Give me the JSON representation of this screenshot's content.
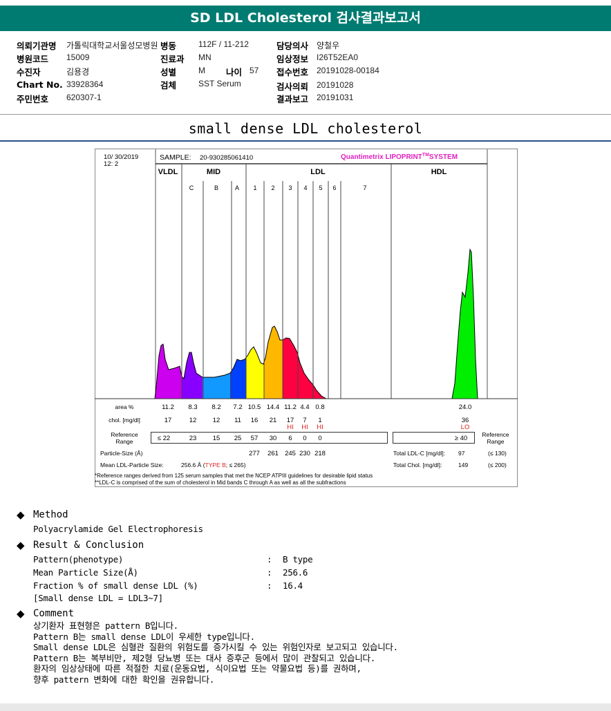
{
  "header": {
    "title": "SD LDL Cholesterol 검사결과보고서"
  },
  "info": {
    "institution_label": "의뢰기관명",
    "institution": "가톨릭대학교서울성모병원",
    "ward_label": "병동",
    "ward": "112F / 11-212",
    "doctor_label": "담당의사",
    "doctor": "양철우",
    "hospital_code_label": "병원코드",
    "hospital_code": "15009",
    "dept_label": "진료과",
    "dept": "MN",
    "clinical_label": "임상정보",
    "clinical": "I26T52EA0",
    "patient_label": "수진자",
    "patient": "김용경",
    "sex_label": "성별",
    "sex": "M",
    "age_label": "나이",
    "age": "57",
    "receipt_label": "접수번호",
    "receipt": "20191028-00184",
    "chart_label": "Chart No.",
    "chart_no": "33928364",
    "specimen_label": "검체",
    "specimen": "SST Serum",
    "request_label": "검사의뢰",
    "request": "20191028",
    "id_label": "주민번호",
    "id": "620307-1",
    "report_label": "결과보고",
    "report": "20191031"
  },
  "subtitle": "small dense LDL cholesterol",
  "chart_data": {
    "type": "area",
    "date": "10/ 30/2019",
    "time": "12:  2",
    "sample_label": "SAMPLE:",
    "sample": "20-930285061410",
    "brand": "Quantimetrix LIPOPRINT",
    "brand_tm": "TM",
    "brand_suffix": "SYSTEM",
    "groups": [
      "VLDL",
      "MID",
      "LDL",
      "HDL"
    ],
    "bands": [
      "C",
      "B",
      "A",
      "1",
      "2",
      "3",
      "4",
      "5",
      "6",
      "7"
    ],
    "band_colors": {
      "VLDL": "#cc00ee",
      "C": "#8800ff",
      "B": "#1199ff",
      "A": "#0040ff",
      "LDL1": "#ffff00",
      "LDL2": "#ffb800",
      "LDL3-7": "#ff0040",
      "HDL": "#00ee00"
    },
    "columns": [
      "VLDL",
      "C",
      "B",
      "A",
      "1",
      "2",
      "3",
      "4",
      "5",
      "HDL"
    ],
    "area_label": "area %",
    "area": [
      "11.2",
      "8.3",
      "8.2",
      "7.2",
      "10.5",
      "14.4",
      "11.2",
      "4.4",
      "0.8",
      "24.0"
    ],
    "chol_label": "chol. [mg/dl]",
    "chol": [
      "17",
      "12",
      "12",
      "11",
      "16",
      "21",
      "17",
      "7",
      "1",
      "36"
    ],
    "flags": [
      "",
      "",
      "",
      "",
      "",
      "",
      "HI",
      "HI",
      "HI",
      "LO"
    ],
    "ref_label": "Reference Range",
    "ref": [
      "≤ 22",
      "23",
      "15",
      "25",
      "57",
      "30",
      "6",
      "0",
      "0",
      "≥ 40"
    ],
    "ref_right_label": "Reference Range",
    "particle_label": "Particle-Size (Å)",
    "particle": [
      "",
      "",
      "",
      "",
      "277",
      "261",
      "245",
      "230",
      "218",
      ""
    ],
    "mean_label": "Mean LDL-Particle Size:",
    "mean_value": "256.6 Å",
    "mean_open": "(",
    "mean_type": "TYPE B",
    "mean_ref": "; ≤ 265)",
    "total_ldl_label": "Total LDL-C [mg/dl]:",
    "total_ldl": "97",
    "total_ldl_ref": "(≤ 130)",
    "total_chol_label": "Total Chol. [mg/dl]:",
    "total_chol": "149",
    "total_chol_ref": "(≤ 200)",
    "footnote1": "*Reference ranges derived from 125 serum samples that met the NCEP ATPIII guidelines for desirable lipid status",
    "footnote2": "**LDL-C is comprised of the sum of cholesterol in Mid bands C through A as well as all the subfractions"
  },
  "method": {
    "title": "Method",
    "text": "Polyacrylamide Gel Electrophoresis"
  },
  "result": {
    "title": "Result & Conclusion",
    "rows": [
      {
        "k": "Pattern(phenotype)",
        "v": "B type"
      },
      {
        "k": "Mean Particle Size(Å)",
        "v": "256.6"
      },
      {
        "k": "Fraction % of small dense LDL (%)",
        "v": "16.4"
      }
    ],
    "note": "[Small dense LDL = LDL3~7]",
    "sep": ":"
  },
  "comment": {
    "title": "Comment",
    "lines": [
      "상기환자 표현형은 pattern B입니다.",
      "Pattern B는 small dense LDL이 우세한 type입니다.",
      "Small dense LDL은 심혈관 질환의 위험도를 증가시킬 수 있는 위험인자로 보고되고 있습니다.",
      "Pattern B는 복부비만, 제2형 당뇨병 또는 대사 증후군 등에서 많이 관찰되고 있습니다.",
      "환자의 임상상태에 따른 적절한 치료(운동요법, 식이요법 또는 약물요법 등)를 권하며,",
      "향후 pattern 변화에 대한 확인을 권유합니다."
    ]
  }
}
